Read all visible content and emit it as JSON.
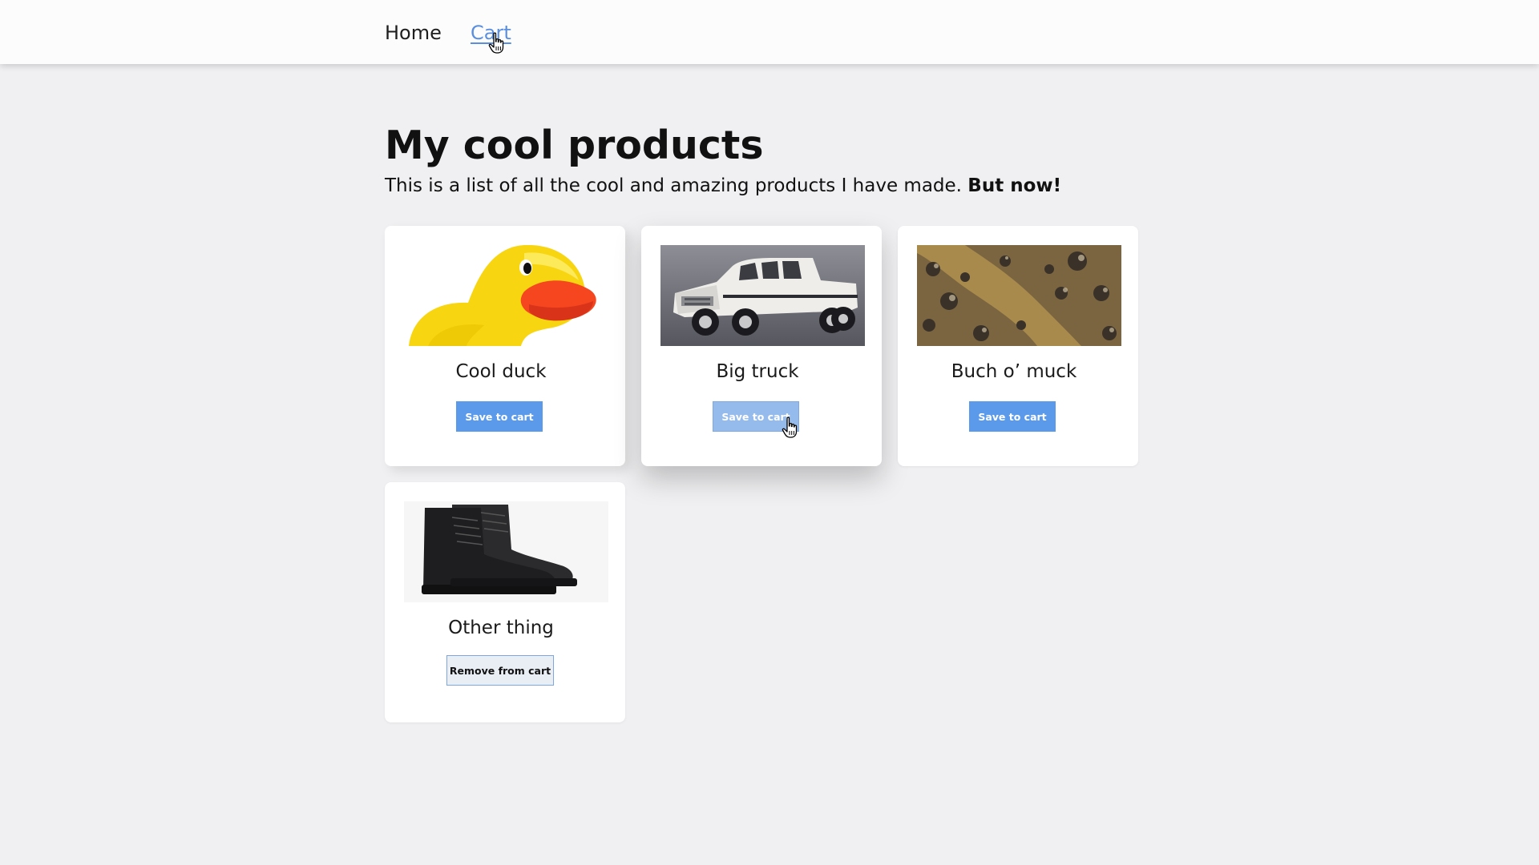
{
  "nav": {
    "home_label": "Home",
    "cart_label": "Cart"
  },
  "hero": {
    "title": "My cool products",
    "subtitle": "This is a list of all the cool and amazing products I have made. ",
    "subtitle_emphasis": "But now!"
  },
  "products": [
    {
      "name": "Cool duck",
      "button_label": "Save to cart",
      "image": "rubber-duck-image"
    },
    {
      "name": "Big truck",
      "button_label": "Save to cart",
      "image": "pickup-truck-image"
    },
    {
      "name": "Buch o’ muck",
      "button_label": "Save to cart",
      "image": "mud-image"
    },
    {
      "name": "Other thing",
      "button_label": "Remove from cart",
      "image": "boots-image"
    }
  ],
  "colors": {
    "accent": "#5b9aeb",
    "link": "#5a8fe0",
    "background": "#f0f0f2"
  }
}
